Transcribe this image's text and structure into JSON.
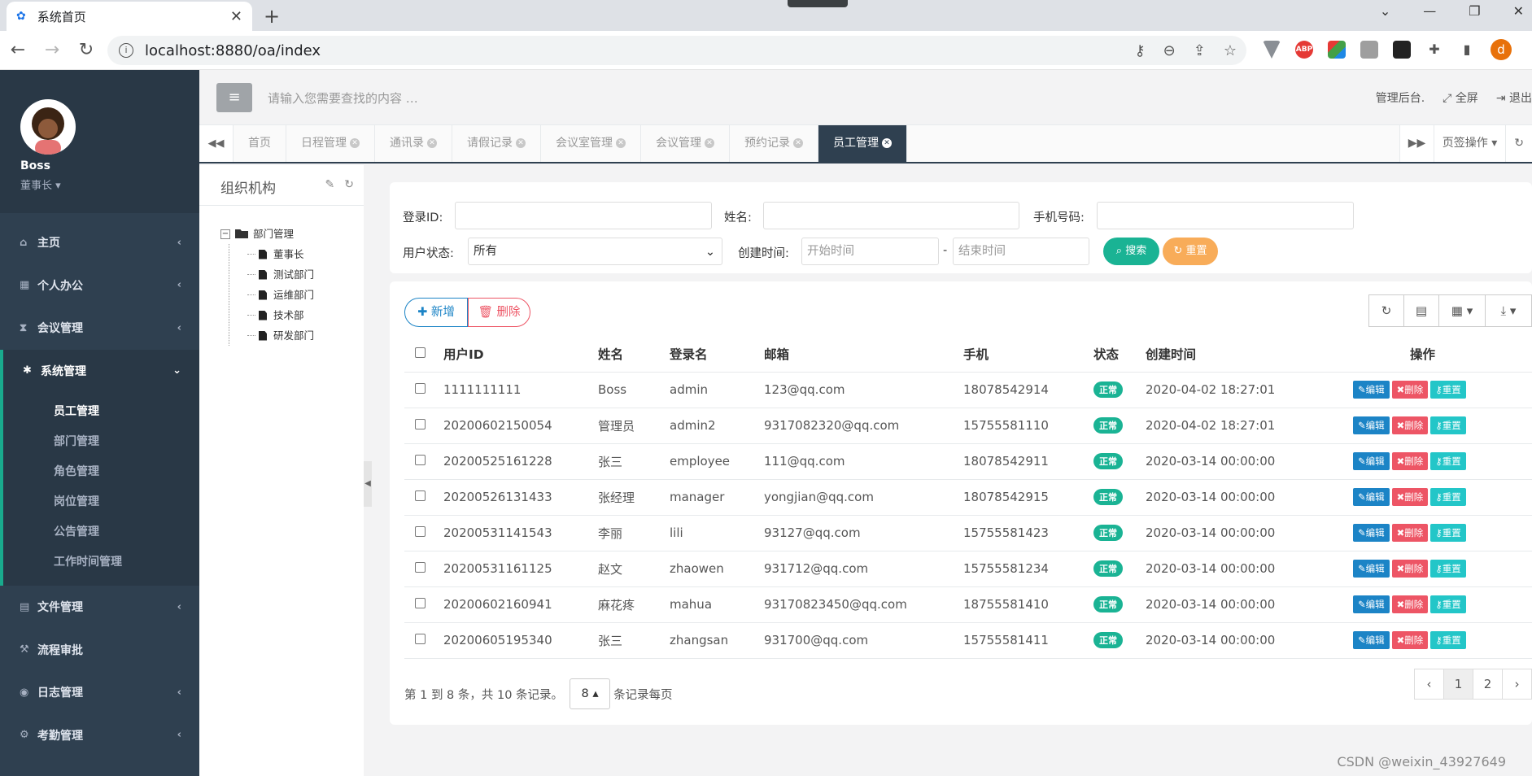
{
  "browser": {
    "tab_title": "系统首页",
    "url": "localhost:8880/oa/index"
  },
  "sidebar": {
    "user_name": "Boss",
    "user_role": "董事长 ▾",
    "items": [
      {
        "label": "主页",
        "icon": "home-icon"
      },
      {
        "label": "个人办公",
        "icon": "calendar-icon"
      },
      {
        "label": "会议管理",
        "icon": "hourglass-icon"
      },
      {
        "label": "系统管理",
        "icon": "gear-icon"
      },
      {
        "label": "文件管理",
        "icon": "file-icon"
      },
      {
        "label": "流程审批",
        "icon": "gavel-icon"
      },
      {
        "label": "日志管理",
        "icon": "eye-icon"
      },
      {
        "label": "考勤管理",
        "icon": "cogs-icon"
      }
    ],
    "submenu": [
      "员工管理",
      "部门管理",
      "角色管理",
      "岗位管理",
      "公告管理",
      "工作时间管理"
    ]
  },
  "appbar": {
    "search_placeholder": "请输入您需要查找的内容 …",
    "admin": "管理后台.",
    "fullscreen": "全屏",
    "logout": "退出"
  },
  "pagetabs": {
    "tabs": [
      "首页",
      "日程管理",
      "通讯录",
      "请假记录",
      "会议室管理",
      "会议管理",
      "预约记录",
      "员工管理"
    ],
    "tab_ops": "页签操作"
  },
  "org": {
    "title": "组织机构",
    "root": "部门管理",
    "children": [
      "董事长",
      "测试部门",
      "运维部门",
      "技术部",
      "研发部门"
    ]
  },
  "search": {
    "login_label": "登录ID:",
    "name_label": "姓名:",
    "phone_label": "手机号码:",
    "status_label": "用户状态:",
    "status_value": "所有",
    "created_label": "创建时间:",
    "start_placeholder": "开始时间",
    "dash": "-",
    "end_placeholder": "结束时间",
    "search_btn": "搜索",
    "reset_btn": "重置"
  },
  "table": {
    "add_btn": "新增",
    "delete_btn": "删除",
    "headers": [
      "用户ID",
      "姓名",
      "登录名",
      "邮箱",
      "手机",
      "状态",
      "创建时间",
      "操作"
    ],
    "actions": {
      "edit": "编辑",
      "del": "删除",
      "reset": "重置"
    },
    "rows": [
      {
        "id": "1111111111",
        "name": "Boss",
        "login": "admin",
        "email": "123@qq.com",
        "phone": "18078542914",
        "status": "正常",
        "created": "2020-04-02 18:27:01"
      },
      {
        "id": "20200602150054",
        "name": "管理员",
        "login": "admin2",
        "email": "9317082320@qq.com",
        "phone": "15755581110",
        "status": "正常",
        "created": "2020-04-02 18:27:01"
      },
      {
        "id": "20200525161228",
        "name": "张三",
        "login": "employee",
        "email": "111@qq.com",
        "phone": "18078542911",
        "status": "正常",
        "created": "2020-03-14 00:00:00"
      },
      {
        "id": "20200526131433",
        "name": "张经理",
        "login": "manager",
        "email": "yongjian@qq.com",
        "phone": "18078542915",
        "status": "正常",
        "created": "2020-03-14 00:00:00"
      },
      {
        "id": "20200531141543",
        "name": "李丽",
        "login": "lili",
        "email": "93127@qq.com",
        "phone": "15755581423",
        "status": "正常",
        "created": "2020-03-14 00:00:00"
      },
      {
        "id": "20200531161125",
        "name": "赵文",
        "login": "zhaowen",
        "email": "931712@qq.com",
        "phone": "15755581234",
        "status": "正常",
        "created": "2020-03-14 00:00:00"
      },
      {
        "id": "20200602160941",
        "name": "麻花疼",
        "login": "mahua",
        "email": "93170823450@qq.com",
        "phone": "18755581410",
        "status": "正常",
        "created": "2020-03-14 00:00:00"
      },
      {
        "id": "20200605195340",
        "name": "张三",
        "login": "zhangsan",
        "email": "931700@qq.com",
        "phone": "15755581411",
        "status": "正常",
        "created": "2020-03-14 00:00:00"
      }
    ],
    "pager_text_1": "第 1 到 8 条，共 10 条记录。",
    "page_size": "8",
    "pager_text_2": "条记录每页",
    "pages": [
      "‹",
      "1",
      "2",
      "›"
    ]
  },
  "watermark": "CSDN @weixin_43927649",
  "colors": {
    "sidebar": "#2f4050",
    "accent": "#1ab394",
    "edit": "#1c84c6",
    "danger": "#ed5565",
    "info": "#23c6c8",
    "warning": "#f8ac59"
  }
}
